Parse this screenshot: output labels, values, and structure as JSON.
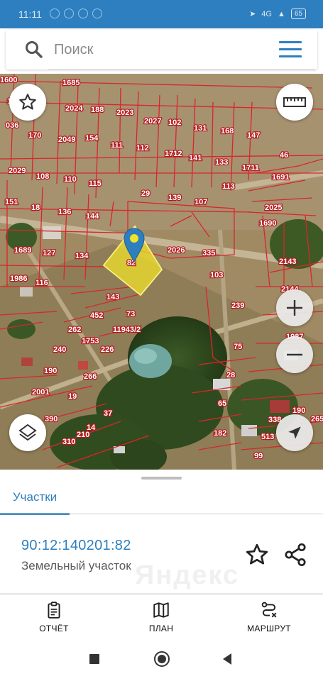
{
  "status": {
    "time": "11:11",
    "signal": "4G",
    "battery": "65"
  },
  "search": {
    "placeholder": "Поиск"
  },
  "map": {
    "selected_label": "82",
    "parcel_labels": [
      "1685",
      "132",
      "2024",
      "188",
      "2023",
      "2027",
      "102",
      "131",
      "168",
      "147",
      "036",
      "170",
      "2049",
      "154",
      "111",
      "112",
      "1712",
      "141",
      "133",
      "1711",
      "46",
      "2029",
      "108",
      "110",
      "115",
      "29",
      "139",
      "107",
      "113",
      "1691",
      "151",
      "18",
      "136",
      "144",
      "2025",
      "1690",
      "1689",
      "127",
      "134",
      "2026",
      "335",
      "2143",
      "1986",
      "116",
      "143",
      "103",
      "2144",
      "452",
      "73",
      "239",
      "1987",
      "262",
      "1753",
      "11943/2",
      "240",
      "226",
      "75",
      "190",
      "266",
      "28",
      "190",
      "2001",
      "19",
      "65",
      "338",
      "265",
      "390",
      "37",
      "182",
      "513",
      "310",
      "210",
      "14",
      "99",
      "1600"
    ]
  },
  "sheet": {
    "tab_label": "Участки",
    "parcel_id": "90:12:140201:82",
    "parcel_type": "Земельный участок"
  },
  "bottom_nav": [
    {
      "label": "ОТЧЁТ",
      "icon": "report-icon"
    },
    {
      "label": "ПЛАН",
      "icon": "map-plan-icon"
    },
    {
      "label": "МАРШРУТ",
      "icon": "route-icon"
    }
  ],
  "colors": {
    "accent": "#2d7fbf",
    "parcel_border": "#d9262b",
    "selected_fill": "#f2e22a"
  }
}
